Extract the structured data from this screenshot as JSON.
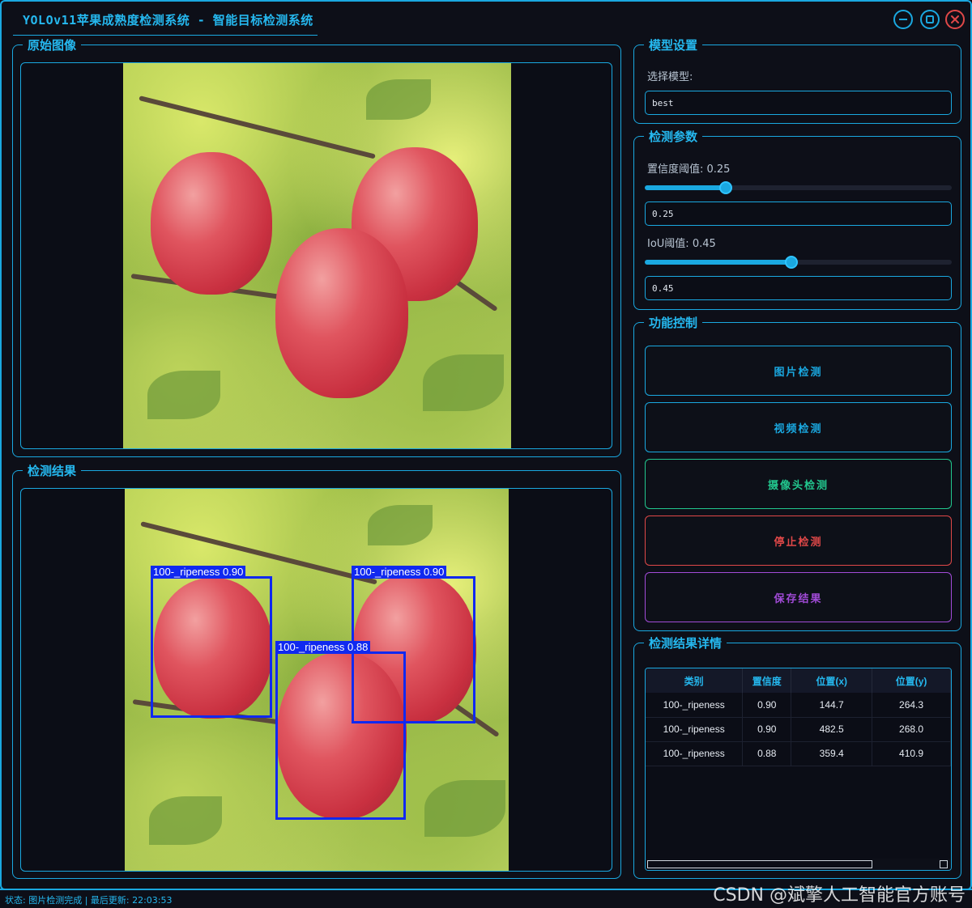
{
  "window": {
    "title": "YOLOv11苹果成熟度检测系统 - 智能目标检测系统"
  },
  "original": {
    "title": "原始图像"
  },
  "result": {
    "title": "检测结果",
    "detections": [
      {
        "label": "100-_ripeness 0.90"
      },
      {
        "label": "100-_ripeness 0.90"
      },
      {
        "label": "100-_ripeness 0.88"
      }
    ]
  },
  "model": {
    "title": "模型设置",
    "select_label": "选择模型:",
    "selected": "best"
  },
  "params": {
    "title": "检测参数",
    "conf_label": "置信度阈值: 0.25",
    "conf_value": "0.25",
    "conf_level": 0.25,
    "iou_label": "IoU阈值: 0.45",
    "iou_value": "0.45",
    "iou_level": 0.45
  },
  "controls": {
    "title": "功能控制",
    "image_btn": "图片检测",
    "video_btn": "视频检测",
    "camera_btn": "摄像头检测",
    "stop_btn": "停止检测",
    "save_btn": "保存结果",
    "colors": {
      "image": "#1aa8e0",
      "video": "#1aa8e0",
      "camera": "#22c78e",
      "stop": "#e04848",
      "save": "#a24bd8"
    }
  },
  "details": {
    "title": "检测结果详情",
    "columns": [
      "类别",
      "置信度",
      "位置(x)",
      "位置(y)"
    ],
    "rows": [
      [
        "100-_ripeness",
        "0.90",
        "144.7",
        "264.3"
      ],
      [
        "100-_ripeness",
        "0.90",
        "482.5",
        "268.0"
      ],
      [
        "100-_ripeness",
        "0.88",
        "359.4",
        "410.9"
      ]
    ]
  },
  "status": {
    "text": "状态: 图片检测完成 | 最后更新: 22:03:53"
  },
  "watermark": "CSDN @斌擎人工智能官方账号"
}
